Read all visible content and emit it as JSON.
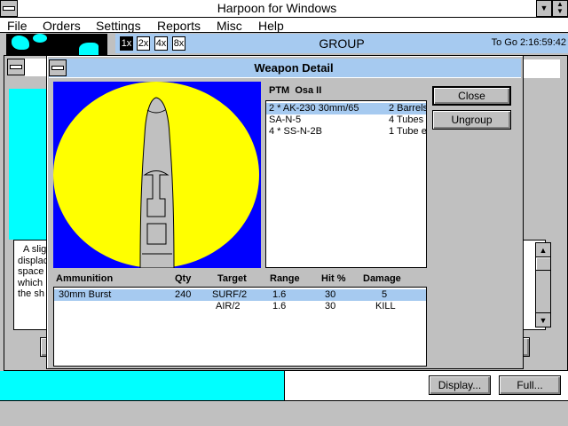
{
  "app": {
    "title": "Harpoon for Windows"
  },
  "menu": [
    "File",
    "Orders",
    "Settings",
    "Reports",
    "Misc",
    "Help"
  ],
  "group_bar": {
    "zoom_buttons": [
      "1x",
      "2x",
      "4x",
      "8x"
    ],
    "selected_zoom": "1x",
    "title": "GROUP",
    "time": "To Go 2:16:59:42"
  },
  "background_window": {
    "description_lines": [
      "A slig",
      "displac",
      "space",
      "which",
      "the sh"
    ],
    "buttons": {
      "display": "Display...",
      "full": "Full..."
    }
  },
  "weapon_detail": {
    "title": "Weapon Detail",
    "ship_label": "PTM  Osa II",
    "weapons": [
      {
        "name": "2 * AK-230 30mm/65",
        "mount": "2 Barrels",
        "selected": true
      },
      {
        "name": "SA-N-5",
        "mount": "4 Tubes",
        "selected": false
      },
      {
        "name": "4 * SS-N-2B",
        "mount": "1 Tube e",
        "selected": false
      }
    ],
    "buttons": {
      "close": "Close",
      "ungroup": "Ungroup"
    },
    "columns": [
      "Ammunition",
      "Qty",
      "Target",
      "Range",
      "Hit %",
      "Damage"
    ],
    "ammo_rows": [
      {
        "ammunition": "30mm Burst",
        "qty": "240",
        "target": "SURF/2",
        "range": "1.6",
        "hit": "30",
        "damage": "5",
        "selected": true
      },
      {
        "ammunition": "",
        "qty": "",
        "target": "AIR/2",
        "range": "1.6",
        "hit": "30",
        "damage": "KILL",
        "selected": false
      }
    ]
  },
  "colors": {
    "highlight": "#a6caf0",
    "cyan": "#00ffff",
    "yellow": "#ffff00",
    "blue": "#0000ff"
  }
}
